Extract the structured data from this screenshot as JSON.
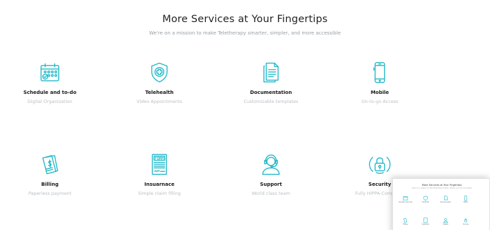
{
  "section": {
    "title": "More Services at Your Fingertips",
    "subtitle": "We're on a mission to make Teletherapy smarter, simpler, and more accessible"
  },
  "services": [
    {
      "title": "Schedule and to-do",
      "desc": "Digital Organization",
      "icon": "calendar-icon"
    },
    {
      "title": "Telehealth",
      "desc": "Video Appointments",
      "icon": "shield-plus-icon"
    },
    {
      "title": "Documentation",
      "desc": "Customizable templates",
      "icon": "document-icon"
    },
    {
      "title": "Mobile",
      "desc": "On-to-go Access",
      "icon": "phone-icon"
    },
    {
      "title": "Billing",
      "desc": "Paperless payment",
      "icon": "invoice-icon"
    },
    {
      "title": "Insuarnace",
      "desc": "Simple claim filling",
      "icon": "form-icon"
    },
    {
      "title": "Support",
      "desc": "World class team",
      "icon": "headset-icon"
    },
    {
      "title": "Security",
      "desc": "Fully HIPPA-Compliant",
      "icon": "padlock-icon"
    }
  ],
  "theme": {
    "accent": "#21b8c7",
    "title_color": "#222222",
    "muted": "#b9bec3"
  }
}
